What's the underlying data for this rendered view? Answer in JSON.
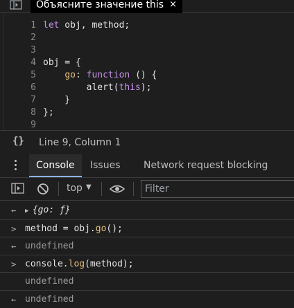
{
  "tab": {
    "title": "Объясните значение this",
    "close": "×"
  },
  "editor": {
    "lines": [
      {
        "n": "1",
        "parts": [
          {
            "t": "let",
            "c": "kw"
          },
          {
            "t": " obj, method;",
            "c": ""
          }
        ]
      },
      {
        "n": "2",
        "parts": []
      },
      {
        "n": "3",
        "parts": []
      },
      {
        "n": "4",
        "parts": [
          {
            "t": "obj = {",
            "c": ""
          }
        ]
      },
      {
        "n": "5",
        "parts": [
          {
            "t": "    ",
            "c": ""
          },
          {
            "t": "go",
            "c": "prop"
          },
          {
            "t": ": ",
            "c": ""
          },
          {
            "t": "function",
            "c": "kw"
          },
          {
            "t": " () {",
            "c": ""
          }
        ]
      },
      {
        "n": "6",
        "parts": [
          {
            "t": "        alert(",
            "c": ""
          },
          {
            "t": "this",
            "c": "kw"
          },
          {
            "t": ");",
            "c": ""
          }
        ]
      },
      {
        "n": "7",
        "parts": [
          {
            "t": "    }",
            "c": ""
          }
        ]
      },
      {
        "n": "8",
        "parts": [
          {
            "t": "};",
            "c": ""
          }
        ]
      },
      {
        "n": "9",
        "parts": []
      }
    ]
  },
  "status": {
    "icon_glyph": "{}",
    "text": "Line 9, Column 1"
  },
  "drawer": {
    "tabs": [
      "Console",
      "Issues",
      "Network request blocking"
    ],
    "active": "Console"
  },
  "toolbar": {
    "context": "top",
    "filter_placeholder": "Filter"
  },
  "console": {
    "rows": [
      {
        "mark": "←",
        "text": "{go: ƒ}",
        "kind": "object"
      },
      {
        "mark": ">",
        "parts": [
          {
            "t": "method = obj.",
            "c": ""
          },
          {
            "t": "go",
            "c": "m-prop"
          },
          {
            "t": "();",
            "c": ""
          }
        ],
        "kind": "input"
      },
      {
        "mark": "←",
        "text": "undefined",
        "kind": "result"
      },
      {
        "mark": ">",
        "parts": [
          {
            "t": "console.",
            "c": ""
          },
          {
            "t": "log",
            "c": "m-prop"
          },
          {
            "t": "(method);",
            "c": ""
          }
        ],
        "kind": "input"
      },
      {
        "mark": "",
        "text": "undefined",
        "kind": "log"
      },
      {
        "mark": "←",
        "text": "undefined",
        "kind": "result"
      }
    ]
  }
}
